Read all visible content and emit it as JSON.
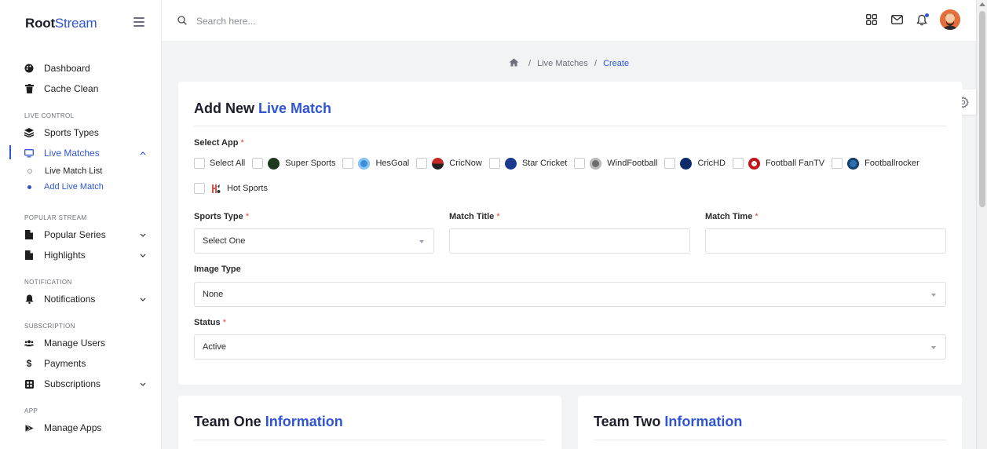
{
  "brand": {
    "part1": "Root",
    "part2": "Stream"
  },
  "search": {
    "placeholder": "Search here..."
  },
  "sidebar": {
    "top_items": [
      {
        "label": "Dashboard",
        "icon": "palette-icon"
      },
      {
        "label": "Cache Clean",
        "icon": "trash-icon"
      }
    ],
    "sections": {
      "live_control": "LIVE CONTROL",
      "popular_stream": "POPULAR STREAM",
      "notification": "NOTIFICATION",
      "subscription": "SUBSCRIPTION",
      "app": "APP"
    },
    "sports_types": "Sports Types",
    "live_matches": "Live Matches",
    "live_match_list": "Live Match List",
    "add_live_match": "Add Live Match",
    "popular_series": "Popular Series",
    "highlights": "Highlights",
    "notifications": "Notifications",
    "manage_users": "Manage Users",
    "payments": "Payments",
    "subscriptions": "Subscriptions",
    "manage_apps": "Manage Apps"
  },
  "breadcrumb": {
    "sep": "/",
    "item1": "Live Matches",
    "current": "Create"
  },
  "form": {
    "title_prefix": "Add New ",
    "title_accent": "Live Match",
    "select_app_label": "Select App",
    "required_mark": "*",
    "apps": [
      {
        "name": "Select All",
        "logo": "",
        "color": ""
      },
      {
        "name": "Super Sports",
        "logo": "super-sports-logo",
        "color": "#1e3a1e"
      },
      {
        "name": "HesGoal",
        "logo": "hesgoal-logo",
        "color": "#3a8fd8"
      },
      {
        "name": "CricNow",
        "logo": "cricnow-logo",
        "color": "#c62828"
      },
      {
        "name": "Star Cricket",
        "logo": "star-cricket-logo",
        "color": "#1a3a8f"
      },
      {
        "name": "WindFootball",
        "logo": "windfootball-logo",
        "color": "#6d6d6d"
      },
      {
        "name": "CricHD",
        "logo": "crichd-logo",
        "color": "#0d2a6b"
      },
      {
        "name": "Football FanTV",
        "logo": "football-fantv-logo",
        "color": "#c3161c"
      },
      {
        "name": "Footballrocker",
        "logo": "footballrocker-logo",
        "color": "#2f6fb0"
      },
      {
        "name": "Hot Sports",
        "logo": "hot-sports-logo",
        "color": "#d9534f"
      }
    ],
    "sports_type_label": "Sports Type",
    "sports_type_value": "Select One",
    "match_title_label": "Match Title",
    "match_title_value": "",
    "match_time_label": "Match Time",
    "match_time_value": "",
    "image_type_label": "Image Type",
    "image_type_value": "None",
    "status_label": "Status",
    "status_value": "Active"
  },
  "team_one": {
    "prefix": "Team One ",
    "accent": "Information"
  },
  "team_two": {
    "prefix": "Team Two ",
    "accent": "Information"
  },
  "colors": {
    "accent": "#2f55d4",
    "required": "#e0473e"
  }
}
